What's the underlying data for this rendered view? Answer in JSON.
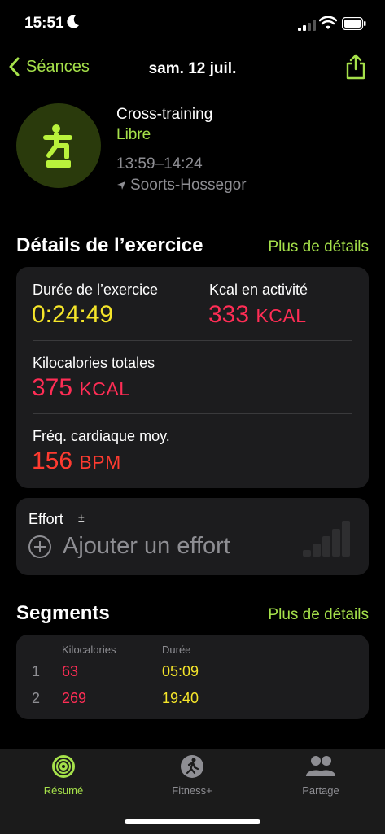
{
  "status_bar": {
    "time": "15:51"
  },
  "nav": {
    "back_label": "Séances",
    "title": "sam. 12 juil."
  },
  "workout": {
    "title": "Cross-training",
    "subtitle": "Libre",
    "time_range": "13:59–14:24",
    "location": "Soorts-Hossegor"
  },
  "details": {
    "heading": "Détails de l’exercice",
    "more": "Plus de détails",
    "duration_label": "Durée de l’exercice",
    "duration_value": "0:24:49",
    "active_kcal_label": "Kcal en activité",
    "active_kcal_value": "333",
    "active_kcal_unit": "KCAL",
    "total_kcal_label": "Kilocalories totales",
    "total_kcal_value": "375",
    "total_kcal_unit": "KCAL",
    "hr_label": "Fréq. cardiaque moy.",
    "hr_value": "156",
    "hr_unit": "BPM"
  },
  "effort": {
    "label": "Effort",
    "symbol": "±",
    "add_label": "Ajouter un effort"
  },
  "segments": {
    "heading": "Segments",
    "more": "Plus de détails",
    "col_kcal": "Kilocalories",
    "col_duration": "Durée",
    "rows": [
      {
        "index": "1",
        "kcal": "63",
        "duration": "05:09"
      },
      {
        "index": "2",
        "kcal": "269",
        "duration": "19:40"
      }
    ]
  },
  "tabs": [
    {
      "label": "Résumé",
      "icon": "activity-rings-icon",
      "active": true
    },
    {
      "label": "Fitness+",
      "icon": "fitness-plus-runner-icon",
      "active": false
    },
    {
      "label": "Partage",
      "icon": "people-icon",
      "active": false
    }
  ],
  "colors": {
    "accent_green": "#a5e04a",
    "duration_yellow": "#f5e52a",
    "kcal_pink": "#ff2d55",
    "bpm_red": "#ff3b30"
  }
}
